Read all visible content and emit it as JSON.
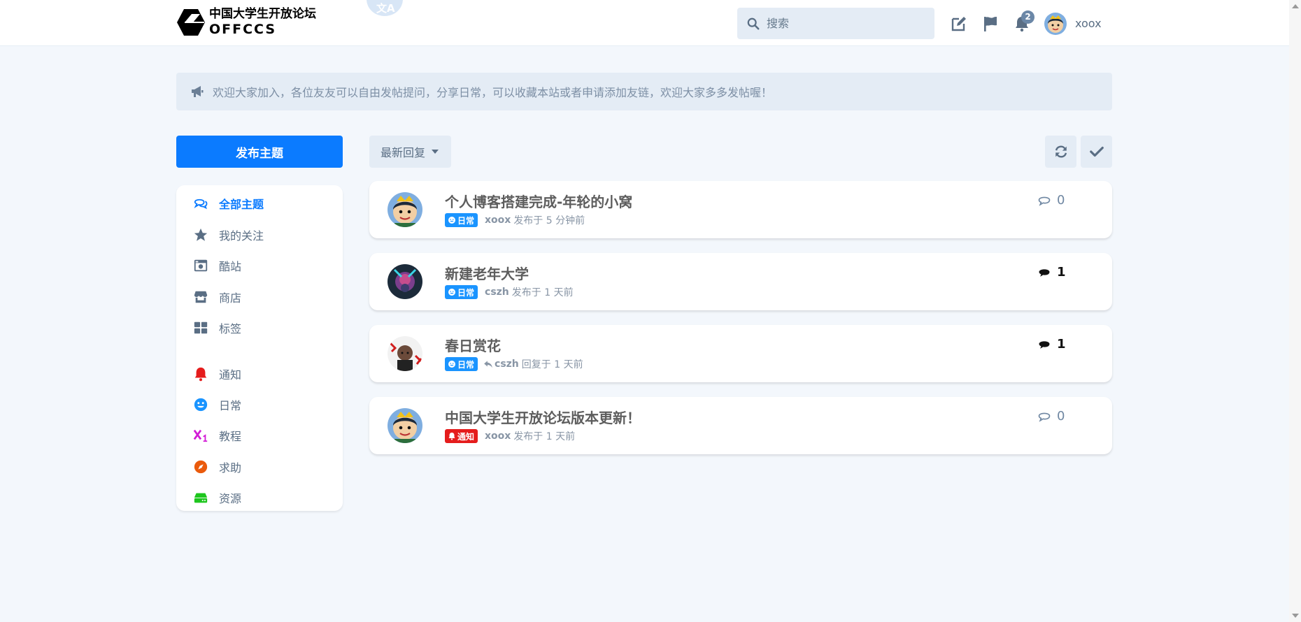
{
  "header": {
    "logo_cn": "中国大学生开放论坛",
    "logo_en": "OFFCCS",
    "translate_glyph": "文A",
    "search_placeholder": "搜索",
    "notification_count": "2",
    "username": "xoox"
  },
  "announcement": {
    "icon": "bullhorn-icon",
    "text": "欢迎大家加入，各位友友可以自由发帖提问，分享日常，可以收藏本站或者申请添加友链，欢迎大家多多发帖喔！"
  },
  "sidebar": {
    "new_discussion_label": "发布主题",
    "items": [
      {
        "label": "全部主题",
        "icon": "comments-icon",
        "active": true
      },
      {
        "label": "我的关注",
        "icon": "star-icon"
      },
      {
        "label": "酷站",
        "icon": "camera-icon"
      },
      {
        "label": "商店",
        "icon": "store-icon"
      },
      {
        "label": "标签",
        "icon": "th-large-icon"
      },
      {
        "label": "通知",
        "icon": "bell-icon",
        "color": "#e51c1c"
      },
      {
        "label": "日常",
        "icon": "smile-icon",
        "color": "#1a94ff"
      },
      {
        "label": "教程",
        "icon": "subscript-icon",
        "color": "#d21bd6"
      },
      {
        "label": "求助",
        "icon": "compass-icon",
        "color": "#ea5a0c"
      },
      {
        "label": "资源",
        "icon": "hdd-icon",
        "color": "#1ec61e"
      }
    ]
  },
  "toolbar": {
    "sort_label": "最新回复",
    "refresh_icon": "sync-icon",
    "mark_read_icon": "check-icon"
  },
  "discussions": [
    {
      "title": "个人博客搭建完成-年轮的小窝",
      "tag": "日常",
      "user": "xoox",
      "time": "发布于 5 分钟前",
      "replies": "0"
    },
    {
      "title": "新建老年大学",
      "tag": "日常",
      "user": "cszh",
      "time": "发布于 1 天前",
      "replies": "1"
    },
    {
      "title": "春日赏花",
      "tag": "日常",
      "user": "cszh",
      "time": "回复于 1 天前",
      "replies": "1"
    },
    {
      "title": "中国大学生开放论坛版本更新！",
      "tag": "通知",
      "user": "xoox",
      "time": "发布于 1 天前",
      "replies": "0"
    }
  ],
  "colors": {
    "accent": "#0b7bff",
    "tag_daily": "#1a94ff",
    "tag_notice": "#e51c1c",
    "background": "#f3f7fc"
  }
}
